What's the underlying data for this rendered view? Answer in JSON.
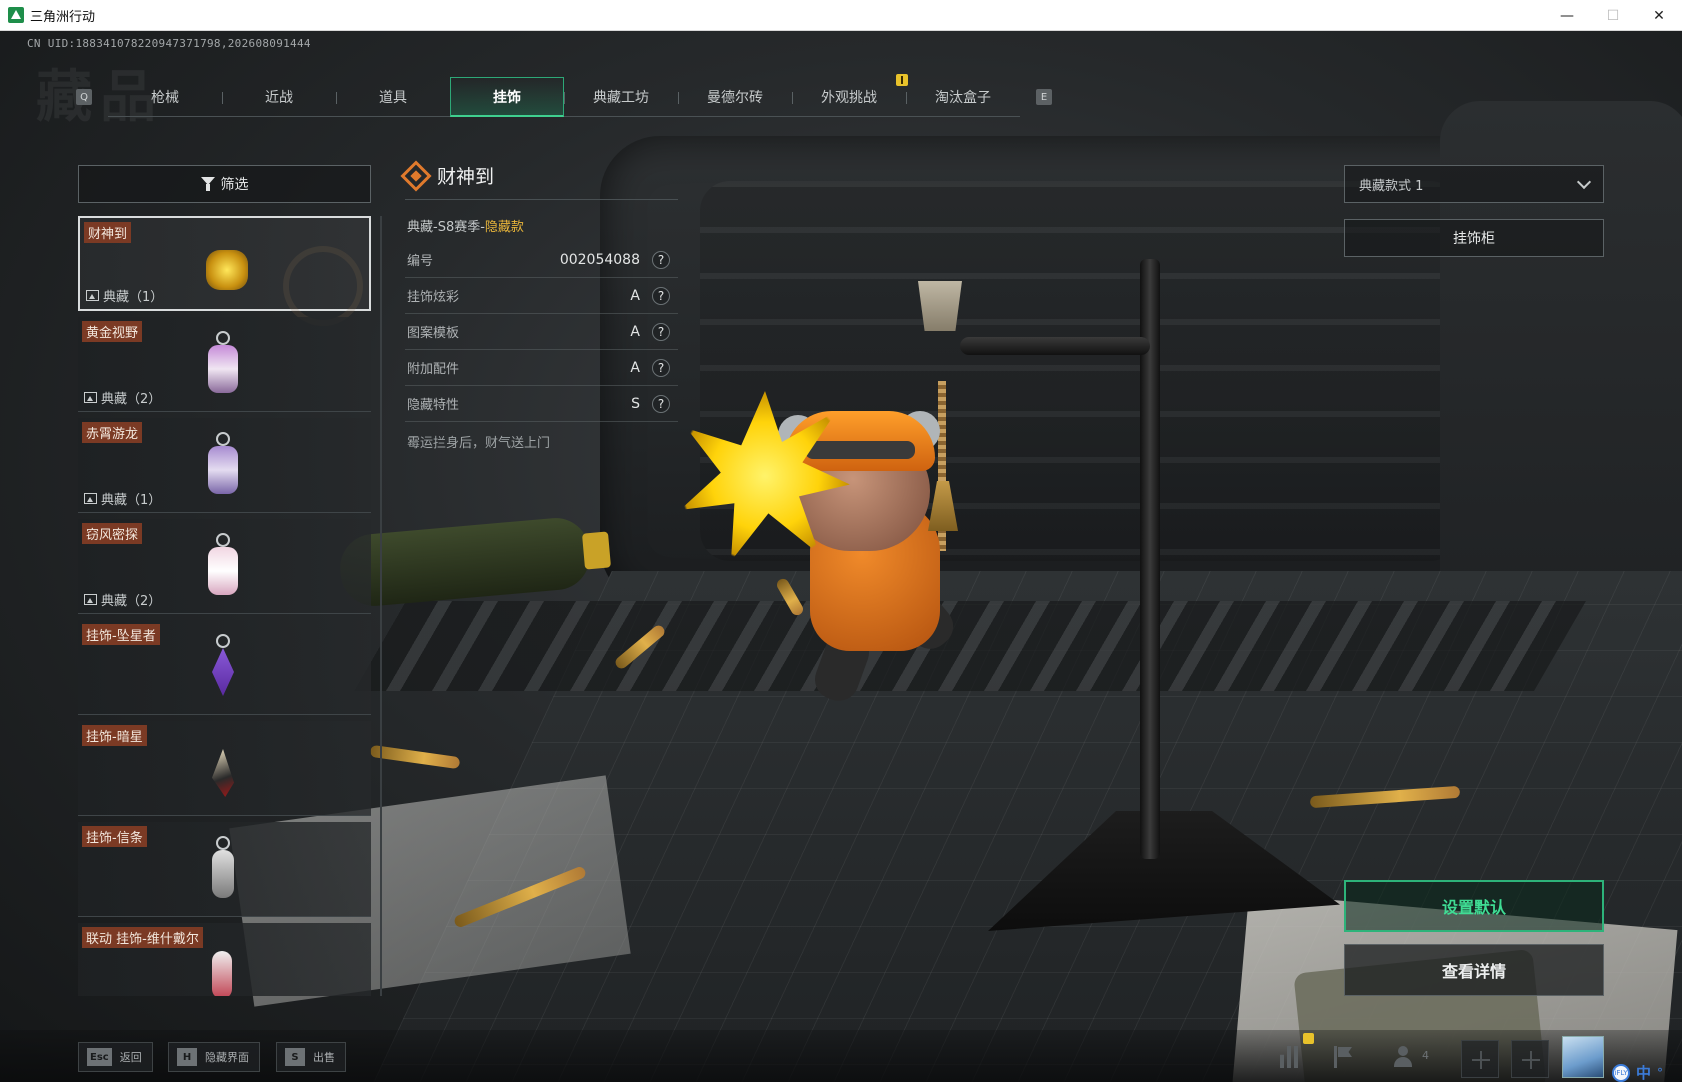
{
  "window": {
    "title": "三角洲行动",
    "controls": [
      "—",
      "☐",
      "✕"
    ]
  },
  "uid": "CN UID:188341078220947371798,202608091444",
  "watermark": "藏品",
  "tabs": {
    "prev_key": "Q",
    "next_key": "E",
    "items": [
      {
        "label": "枪械"
      },
      {
        "label": "近战"
      },
      {
        "label": "道具"
      },
      {
        "label": "挂饰",
        "active": true
      },
      {
        "label": "典藏工坊"
      },
      {
        "label": "曼德尔砖"
      },
      {
        "label": "外观挑战"
      },
      {
        "label": "淘汰盒子"
      }
    ]
  },
  "filter": {
    "label": "筛选"
  },
  "list": {
    "items": [
      {
        "name": "财神到",
        "count": "典藏（1）",
        "selected": true
      },
      {
        "name": "黄金视野",
        "count": "典藏（2）"
      },
      {
        "name": "赤霄游龙",
        "count": "典藏（1）"
      },
      {
        "name": "窃风密探",
        "count": "典藏（2）"
      },
      {
        "name": "挂饰-坠星者",
        "count": ""
      },
      {
        "name": "挂饰-暗星",
        "count": ""
      },
      {
        "name": "挂饰-信条",
        "count": ""
      },
      {
        "name": "联动 挂饰-维什戴尔",
        "count": ""
      }
    ]
  },
  "detail": {
    "title": "财神到",
    "tier_prefix": "典藏-S8赛季-",
    "tier_hidden": "隐藏款",
    "attributes": [
      {
        "label": "编号",
        "value": "002054088"
      },
      {
        "label": "挂饰炫彩",
        "value": "A"
      },
      {
        "label": "图案模板",
        "value": "A"
      },
      {
        "label": "附加配件",
        "value": "A"
      },
      {
        "label": "隐藏特性",
        "value": "S"
      }
    ],
    "help_icon": "?",
    "description": "霉运拦身后，财气送上门"
  },
  "right_panel": {
    "style_select": "典藏款式 1",
    "cabinet_button": "挂饰柜",
    "default_button": "设置默认",
    "details_button": "查看详情"
  },
  "bottom_bar": {
    "hints": [
      {
        "key": "Esc",
        "label": "返回"
      },
      {
        "key": "H",
        "label": "隐藏界面"
      },
      {
        "key": "S",
        "label": "出售"
      }
    ],
    "friend_count": "4",
    "ime": {
      "badge": "iFLY",
      "mode": "中",
      "dot": "°"
    }
  },
  "colors": {
    "accent_green": "#3fdc94",
    "tag_brown": "#7b3a24",
    "hidden_gold": "#e8b53a",
    "title_diamond": "#e07a2c"
  }
}
